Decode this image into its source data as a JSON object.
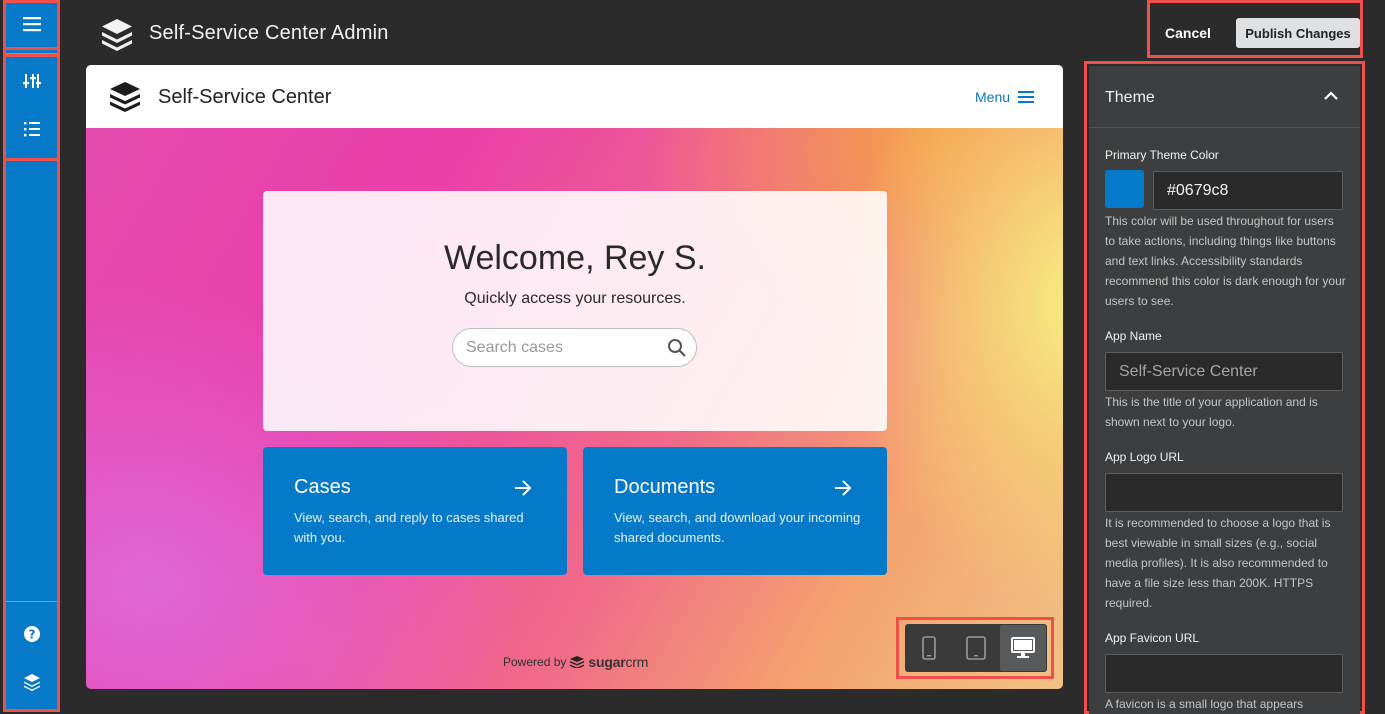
{
  "header": {
    "title": "Self-Service Center Admin",
    "cancel_label": "Cancel",
    "publish_label": "Publish Changes"
  },
  "rail": {
    "icons": [
      "menu-icon",
      "sliders-icon",
      "list-icon",
      "help-icon",
      "layers-icon"
    ]
  },
  "preview": {
    "app_title": "Self-Service Center",
    "menu_label": "Menu",
    "welcome_title": "Welcome, Rey S.",
    "welcome_sub": "Quickly access your resources.",
    "search_placeholder": "Search cases",
    "cards": [
      {
        "title": "Cases",
        "desc": "View, search, and reply to cases shared with you."
      },
      {
        "title": "Documents",
        "desc": "View, search, and download your incoming shared documents."
      }
    ],
    "powered_by": "Powered by",
    "brand_bold": "sugar",
    "brand_light": "crm",
    "devices": [
      "phone-icon",
      "tablet-icon",
      "desktop-icon"
    ],
    "active_device": "desktop"
  },
  "panel": {
    "section_title": "Theme",
    "primary_label": "Primary Theme Color",
    "primary_value": "#0679c8",
    "primary_help": "This color will be used throughout for users to take actions, including things like buttons and text links. Accessibility standards recommend this color is dark enough for your users to see.",
    "app_name_label": "App Name",
    "app_name_placeholder": "Self-Service Center",
    "app_name_help": "This is the title of your application and is shown next to your logo.",
    "logo_url_label": "App Logo URL",
    "logo_url_help": "It is recommended to choose a logo that is best viewable in small sizes (e.g., social media profiles). It is also recommended to have a file size less than 200K. HTTPS required.",
    "favicon_label": "App Favicon URL",
    "favicon_help": "A favicon is a small logo that appears"
  },
  "colors": {
    "accent": "#0679c8",
    "highlight": "#f0504a",
    "background": "#2b2b2c"
  }
}
